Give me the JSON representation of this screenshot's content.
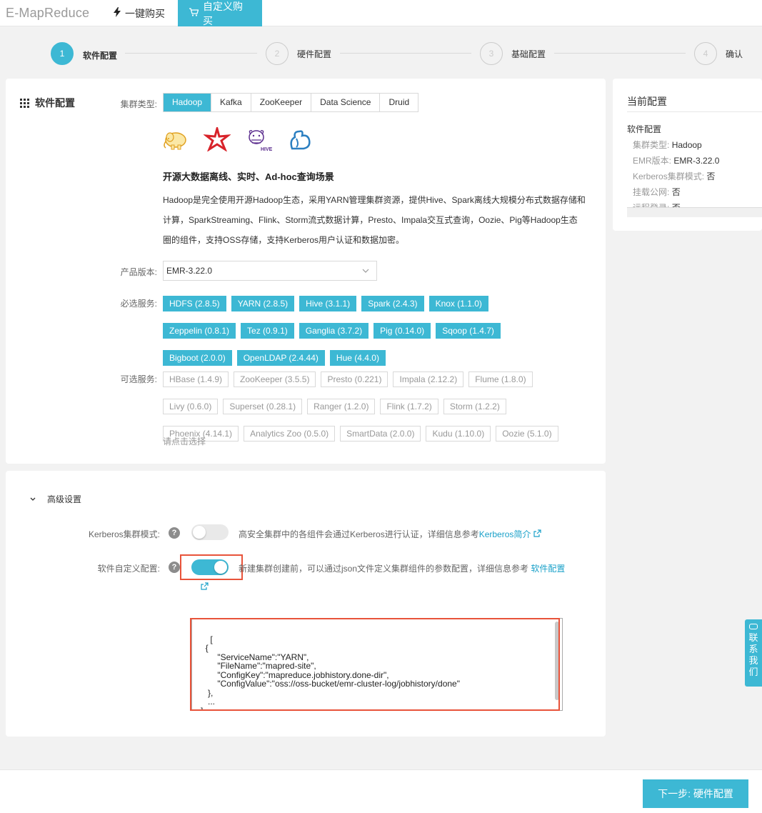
{
  "header": {
    "brand": "E-MapReduce",
    "quick_buy": "一键购买",
    "custom_buy": "自定义购买"
  },
  "steps": [
    {
      "num": "1",
      "label": "软件配置",
      "active": true
    },
    {
      "num": "2",
      "label": "硬件配置",
      "active": false
    },
    {
      "num": "3",
      "label": "基础配置",
      "active": false
    },
    {
      "num": "4",
      "label": "确认",
      "active": false
    }
  ],
  "software": {
    "section_title": "软件配置",
    "cluster_type_label": "集群类型:",
    "cluster_types": [
      "Hadoop",
      "Kafka",
      "ZooKeeper",
      "Data Science",
      "Druid"
    ],
    "selected_cluster_type": "Hadoop",
    "headline": "开源大数据离线、实时、Ad-hoc查询场景",
    "desc_lines": [
      "Hadoop是完全使用开源Hadoop生态，采用YARN管理集群资源，提供Hive、Spark离线大规模分布式数据存储和",
      "计算，SparkStreaming、Flink、Storm流式数据计算，Presto、Impala交互式查询，Oozie、Pig等Hadoop生态",
      "圈的组件，支持OSS存储，支持Kerberos用户认证和数据加密。"
    ],
    "version_label": "产品版本:",
    "version_value": "EMR-3.22.0",
    "required_label": "必选服务:",
    "required_services": [
      "HDFS (2.8.5)",
      "YARN (2.8.5)",
      "Hive (3.1.1)",
      "Spark (2.4.3)",
      "Knox (1.1.0)",
      "Zeppelin (0.8.1)",
      "Tez (0.9.1)",
      "Ganglia (3.7.2)",
      "Pig (0.14.0)",
      "Sqoop (1.4.7)",
      "Bigboot (2.0.0)",
      "OpenLDAP (2.4.44)",
      "Hue (4.4.0)"
    ],
    "optional_label": "可选服务:",
    "optional_services": [
      "HBase (1.4.9)",
      "ZooKeeper (3.5.5)",
      "Presto (0.221)",
      "Impala (2.12.2)",
      "Flume (1.8.0)",
      "Livy (0.6.0)",
      "Superset (0.28.1)",
      "Ranger (1.2.0)",
      "Flink (1.7.2)",
      "Storm (1.2.2)",
      "Phoenix (4.14.1)",
      "Analytics Zoo (0.5.0)",
      "SmartData (2.0.0)",
      "Kudu (1.10.0)",
      "Oozie (5.1.0)"
    ],
    "optional_hint": "请点击选择"
  },
  "advanced": {
    "title": "高级设置",
    "kerberos_label": "Kerberos集群模式:",
    "kerberos_desc": "高安全集群中的各组件会通过Kerberos进行认证，详细信息参考",
    "kerberos_link": "Kerberos简介",
    "custom_label": "软件自定义配置:",
    "custom_desc": "新建集群创建前，可以通过json文件定义集群组件的参数配置，详细信息参考 ",
    "custom_link": "软件配置",
    "json_text": "[\n  {\n       \"ServiceName\":\"YARN\",\n       \"FileName\":\"mapred-site\",\n       \"ConfigKey\":\"mapreduce.jobhistory.done-dir\",\n       \"ConfigValue\":\"oss://oss-bucket/emr-cluster-log/jobhistory/done\"\n   },\n   ...\n]"
  },
  "current": {
    "title": "当前配置",
    "sub": "软件配置",
    "rows": [
      {
        "k": "集群类型:",
        "v": "Hadoop"
      },
      {
        "k": "EMR版本:",
        "v": "EMR-3.22.0"
      },
      {
        "k": "Kerberos集群模式:",
        "v": "否"
      },
      {
        "k": "挂载公网:",
        "v": "否"
      },
      {
        "k": "远程登录:",
        "v": "否"
      }
    ]
  },
  "footer": {
    "next": "下一步: 硬件配置"
  },
  "contact": [
    "联",
    "系",
    "我",
    "们"
  ],
  "colors": {
    "accent": "#3db8d4",
    "highlight": "#e8533a"
  }
}
